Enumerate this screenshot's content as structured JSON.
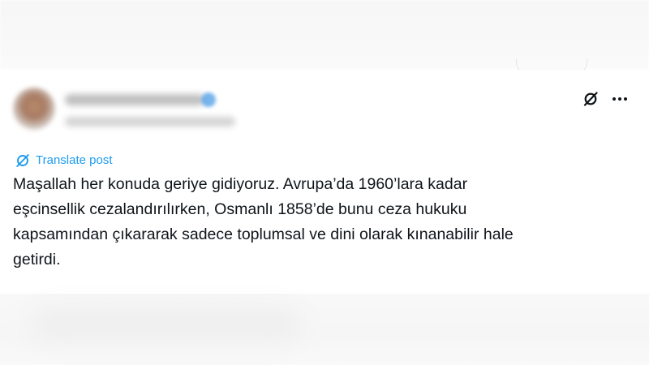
{
  "post": {
    "translate_label": "Translate post",
    "text": "Maşallah her konuda geriye gidiyoruz. Avrupa’da 1960’lara kadar\neşcinsellik cezalandırılırken, Osmanlı 1858’de bunu ceza hukuku\nkapsamından çıkararak sadece toplumsal ve dini olarak kınanabilir hale\ngetirdi."
  },
  "icons": {
    "grok": "grok-icon",
    "more": "more-options-icon",
    "translate": "translate-icon",
    "verified": "verified-badge-icon"
  },
  "colors": {
    "link": "#1d9bf0",
    "text": "#0f1419",
    "icon": "#0f1419"
  }
}
